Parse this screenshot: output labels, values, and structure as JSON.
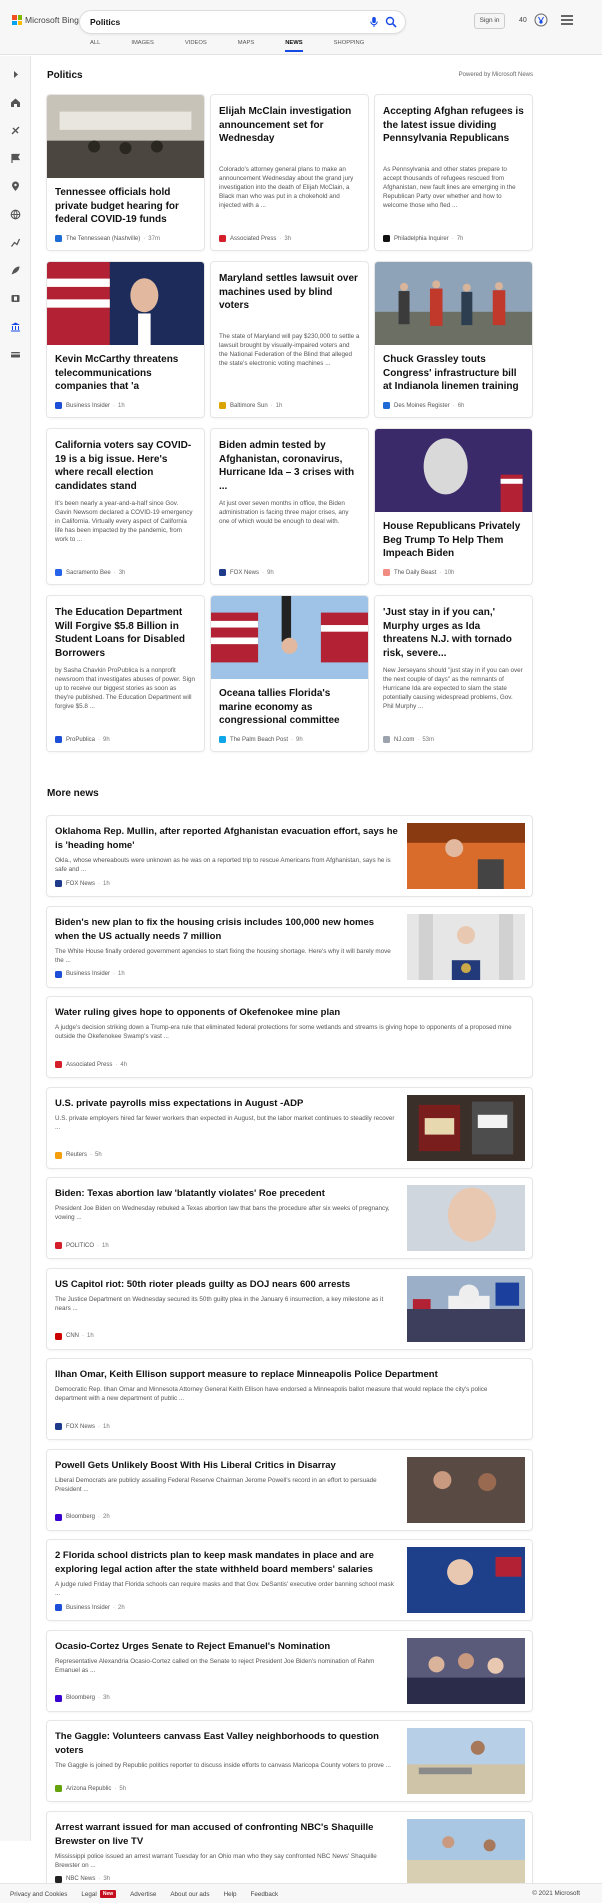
{
  "header": {
    "logo_text": "Microsoft Bing",
    "search_value": "Politics",
    "signin_label": "Sign in",
    "points": "40"
  },
  "nav": {
    "tabs": [
      "ALL",
      "IMAGES",
      "VIDEOS",
      "MAPS",
      "NEWS",
      "SHOPPING"
    ],
    "active": "NEWS"
  },
  "section": {
    "title": "Politics",
    "powered": "Powered by Microsoft News"
  },
  "cards": [
    {
      "title": "Tennessee officials hold private budget hearing for federal COVID-19 funds",
      "snippet": "",
      "source": "The Tennessean (Nashville)",
      "time": "37m",
      "src_color": "#1f6bd6",
      "has_image": true
    },
    {
      "title": "Elijah McClain investigation announcement set for Wednesday",
      "snippet": "Colorado's attorney general plans to make an announcement Wednesday about the grand jury investigation into the death of Elijah McClain, a Black man who was put in a chokehold and injected with a ...",
      "source": "Associated Press",
      "time": "3h",
      "src_color": "#d41f2b",
      "has_image": false
    },
    {
      "title": "Accepting Afghan refugees is the latest issue dividing Pennsylvania Republicans",
      "snippet": "As Pennsylvania and other states prepare to accept thousands of refugees rescued from Afghanistan, new fault lines are emerging in the Republican Party over whether and how to welcome those who fled ...",
      "source": "Philadelphia Inquirer",
      "time": "7h",
      "src_color": "#111111",
      "has_image": false
    },
    {
      "title": "Kevin McCarthy threatens telecommunications companies that 'a Republican...",
      "snippet": "",
      "source": "Business Insider",
      "time": "1h",
      "src_color": "#1d4ed8",
      "has_image": true
    },
    {
      "title": "Maryland settles lawsuit over machines used by blind voters",
      "snippet": "The state of Maryland will pay $230,000 to settle a lawsuit brought by visually-impaired voters and the National Federation of the Blind that alleged the state's electronic voting machines ...",
      "source": "Baltimore Sun",
      "time": "1h",
      "src_color": "#d9a400",
      "has_image": false
    },
    {
      "title": "Chuck Grassley touts Congress' infrastructure bill at Indianola linemen training facility",
      "snippet": "",
      "source": "Des Moines Register",
      "time": "6h",
      "src_color": "#1f6bd6",
      "has_image": true
    },
    {
      "title": "California voters say COVID-19 is a big issue. Here's where recall election candidates stand",
      "snippet": "It's been nearly a year-and-a-half since Gov. Gavin Newsom declared a COVID-19 emergency in California. Virtually every aspect of California life has been impacted by the pandemic, from work to ...",
      "source": "Sacramento Bee",
      "time": "3h",
      "src_color": "#2563eb",
      "has_image": false
    },
    {
      "title": "Biden admin tested by Afghanistan, coronavirus, Hurricane Ida – 3 crises with ...",
      "snippet": "At just over seven months in office, the Biden administration is facing three major crises, any one of which would be enough to deal with.",
      "source": "FOX News",
      "time": "9h",
      "src_color": "#1e3a8a",
      "has_image": false
    },
    {
      "title": "House Republicans Privately Beg Trump To Help Them Impeach Biden",
      "snippet": "",
      "source": "The Daily Beast",
      "time": "10h",
      "src_color": "#f28b82",
      "has_image": true
    },
    {
      "title": "The Education Department Will Forgive $5.8 Billion in Student Loans for Disabled Borrowers",
      "snippet": "by Sasha Chavkin ProPublica is a nonprofit newsroom that investigates abuses of power. Sign up to receive our biggest stories as soon as they're published. The Education Department will forgive $5.8 ...",
      "source": "ProPublica",
      "time": "9h",
      "src_color": "#1d4ed8",
      "has_image": false
    },
    {
      "title": "Oceana tallies Florida's marine economy as congressional committee offers offshore oil...",
      "snippet": "",
      "source": "The Palm Beach Post",
      "time": "9h",
      "src_color": "#0ea5e9",
      "has_image": true
    },
    {
      "title": "'Just stay in if you can,' Murphy urges as Ida threatens N.J. with tornado risk, severe...",
      "snippet": "New Jerseyans should \"just stay in if you can over the next couple of days\" as the remnants of Hurricane Ida are expected to slam the state potentially causing widespread problems, Gov. Phil Murphy ...",
      "source": "NJ.com",
      "time": "53m",
      "src_color": "#9ca3af",
      "has_image": false
    }
  ],
  "more": {
    "title": "More news",
    "items": [
      {
        "title": "Oklahoma Rep. Mullin, after reported Afghanistan evacuation effort, says he is 'heading home'",
        "snippet": "Okla., whose whereabouts were unknown as he was on a reported trip to rescue Americans from Afghanistan, says he is safe and ...",
        "source": "FOX News",
        "time": "1h",
        "src_color": "#1e3a8a",
        "has_image": true
      },
      {
        "title": "Biden's new plan to fix the housing crisis includes 100,000 new homes when the US actually needs 7 million",
        "snippet": "The White House finally ordered government agencies to start fixing the housing shortage. Here's why it will barely move the ...",
        "source": "Business Insider",
        "time": "1h",
        "src_color": "#1d4ed8",
        "has_image": true
      },
      {
        "title": "Water ruling gives hope to opponents of Okefenokee mine plan",
        "snippet": "A judge's decision striking down a Trump-era rule that eliminated federal protections for some wetlands and streams is giving hope to opponents of a proposed mine outside the Okefenokee Swamp's vast ...",
        "source": "Associated Press",
        "time": "4h",
        "src_color": "#d41f2b",
        "has_image": false
      },
      {
        "title": "U.S. private payrolls miss expectations in August -ADP",
        "snippet": "U.S. private employers hired far fewer workers than expected in August, but the labor market continues to steadily recover ...",
        "source": "Reuters",
        "time": "5h",
        "src_color": "#f59e0b",
        "has_image": true
      },
      {
        "title": "Biden: Texas abortion law 'blatantly violates' Roe precedent",
        "snippet": "President Joe Biden on Wednesday rebuked a Texas abortion law that bans the procedure after six weeks of pregnancy, vowing ...",
        "source": "POLITICO",
        "time": "1h",
        "src_color": "#d41f2b",
        "has_image": true
      },
      {
        "title": "US Capitol riot: 50th rioter pleads guilty as DOJ nears 600 arrests",
        "snippet": "The Justice Department on Wednesday secured its 50th guilty plea in the January 6 insurrection, a key milestone as it nears ...",
        "source": "CNN",
        "time": "1h",
        "src_color": "#cc0000",
        "has_image": true
      },
      {
        "title": "Ilhan Omar, Keith Ellison support measure to replace Minneapolis Police Department",
        "snippet": "Democratic Rep. Ilhan Omar and Minnesota Attorney General Keith Ellison have endorsed a Minneapolis ballot measure that would replace the city's police department with a new department of public ...",
        "source": "FOX News",
        "time": "1h",
        "src_color": "#1e3a8a",
        "has_image": false
      },
      {
        "title": "Powell Gets Unlikely Boost With His Liberal Critics in Disarray",
        "snippet": "Liberal Democrats are publicly assailing Federal Reserve Chairman Jerome Powell's record in an effort to persuade President ...",
        "source": "Bloomberg",
        "time": "2h",
        "src_color": "#3b00d1",
        "has_image": true
      },
      {
        "title": "2 Florida school districts plan to keep mask mandates in place and are exploring legal action after the state withheld board members' salaries",
        "snippet": "A judge ruled Friday that Florida schools can require masks and that Gov. DeSantis' executive order banning school mask ...",
        "source": "Business Insider",
        "time": "2h",
        "src_color": "#1d4ed8",
        "has_image": true
      },
      {
        "title": "Ocasio-Cortez Urges Senate to Reject Emanuel's Nomination",
        "snippet": "Representative Alexandria Ocasio-Cortez called on the Senate to reject President Joe Biden's nomination of Rahm Emanuel as ...",
        "source": "Bloomberg",
        "time": "3h",
        "src_color": "#3b00d1",
        "has_image": true
      },
      {
        "title": "The Gaggle: Volunteers canvass East Valley neighborhoods to question voters",
        "snippet": "The Gaggle is joined by Republic politics reporter to discuss inside efforts to canvass Maricopa County voters to prove ...",
        "source": "Arizona Republic",
        "time": "5h",
        "src_color": "#65a30d",
        "has_image": true
      },
      {
        "title": "Arrest warrant issued for man accused of confronting NBC's Shaquille Brewster on live TV",
        "snippet": "Mississippi police issued an arrest warrant Tuesday for an Ohio man who they say confronted NBC News' Shaquille Brewster on ...",
        "source": "NBC News",
        "time": "3h",
        "src_color": "#222222",
        "has_image": true
      }
    ]
  },
  "footer": {
    "links": [
      "Privacy and Cookies",
      "Legal",
      "Advertise",
      "About our ads",
      "Help",
      "Feedback"
    ],
    "new_badge": "New",
    "copyright": "© 2021 Microsoft"
  },
  "colors": {
    "accent": "#174ae4",
    "ms_red": "#f25022",
    "ms_green": "#7fba00",
    "ms_blue": "#00a4ef",
    "ms_yellow": "#ffb900"
  }
}
